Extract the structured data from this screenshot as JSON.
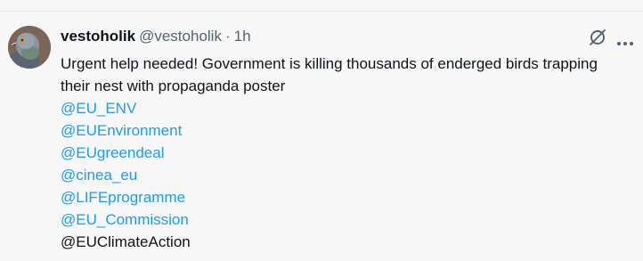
{
  "tweet": {
    "author_name": "vestoholik",
    "handle": "@vestoholik",
    "separator": "·",
    "time": "1h",
    "body": "Urgent help needed! Government is killing thousands of enderged birds trapping their nest with propaganda poster",
    "mentions": [
      {
        "text": "@EU_ENV",
        "linked": true
      },
      {
        "text": "@EUEnvironment",
        "linked": true
      },
      {
        "text": "@EUgreendeal",
        "linked": true
      },
      {
        "text": "@cinea_eu",
        "linked": true
      },
      {
        "text": "@LIFEprogramme",
        "linked": true
      },
      {
        "text": "@EU_Commission",
        "linked": true
      },
      {
        "text": "@EUClimateAction",
        "linked": false
      }
    ],
    "icons": {
      "avatar": "pigeon-avatar",
      "grok": "grok-icon",
      "more": "more-icon"
    },
    "colors": {
      "link": "#1d9bf0",
      "secondary_text": "#536471",
      "primary_text": "#0f1419",
      "background": "#f7f7f7"
    }
  }
}
